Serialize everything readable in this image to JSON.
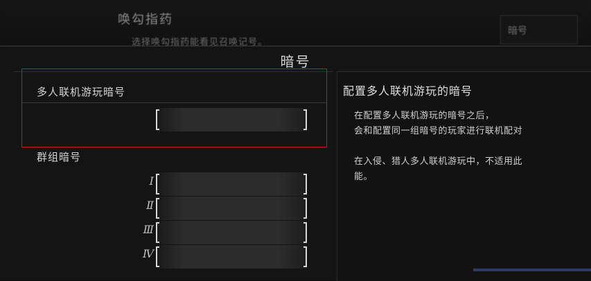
{
  "background_menu": {
    "title": "唤勾指药",
    "subtitle": "选择唤勾指药能看见召唤记号。",
    "field_label": "暗号"
  },
  "dialog": {
    "title": "暗号",
    "multiplayer": {
      "label": "多人联机游玩暗号",
      "value": ""
    },
    "group": {
      "label": "群组暗号",
      "slots": [
        {
          "index": "Ⅰ",
          "value": ""
        },
        {
          "index": "Ⅱ",
          "value": ""
        },
        {
          "index": "Ⅲ",
          "value": ""
        },
        {
          "index": "Ⅳ",
          "value": ""
        }
      ]
    },
    "info": {
      "title": "配置多人联机游玩的暗号",
      "lines": [
        "在配置多人联机游玩的暗号之后，",
        "会和配置同一组暗号的玩家进行联机配对",
        "在入侵、猎人多人联机游玩中，不适用此",
        "能。"
      ]
    }
  },
  "colors": {
    "highlight": "#c21b1b",
    "background": "#141414",
    "text": "#d6d6d6",
    "footer_accent": "#2c3b6e"
  }
}
